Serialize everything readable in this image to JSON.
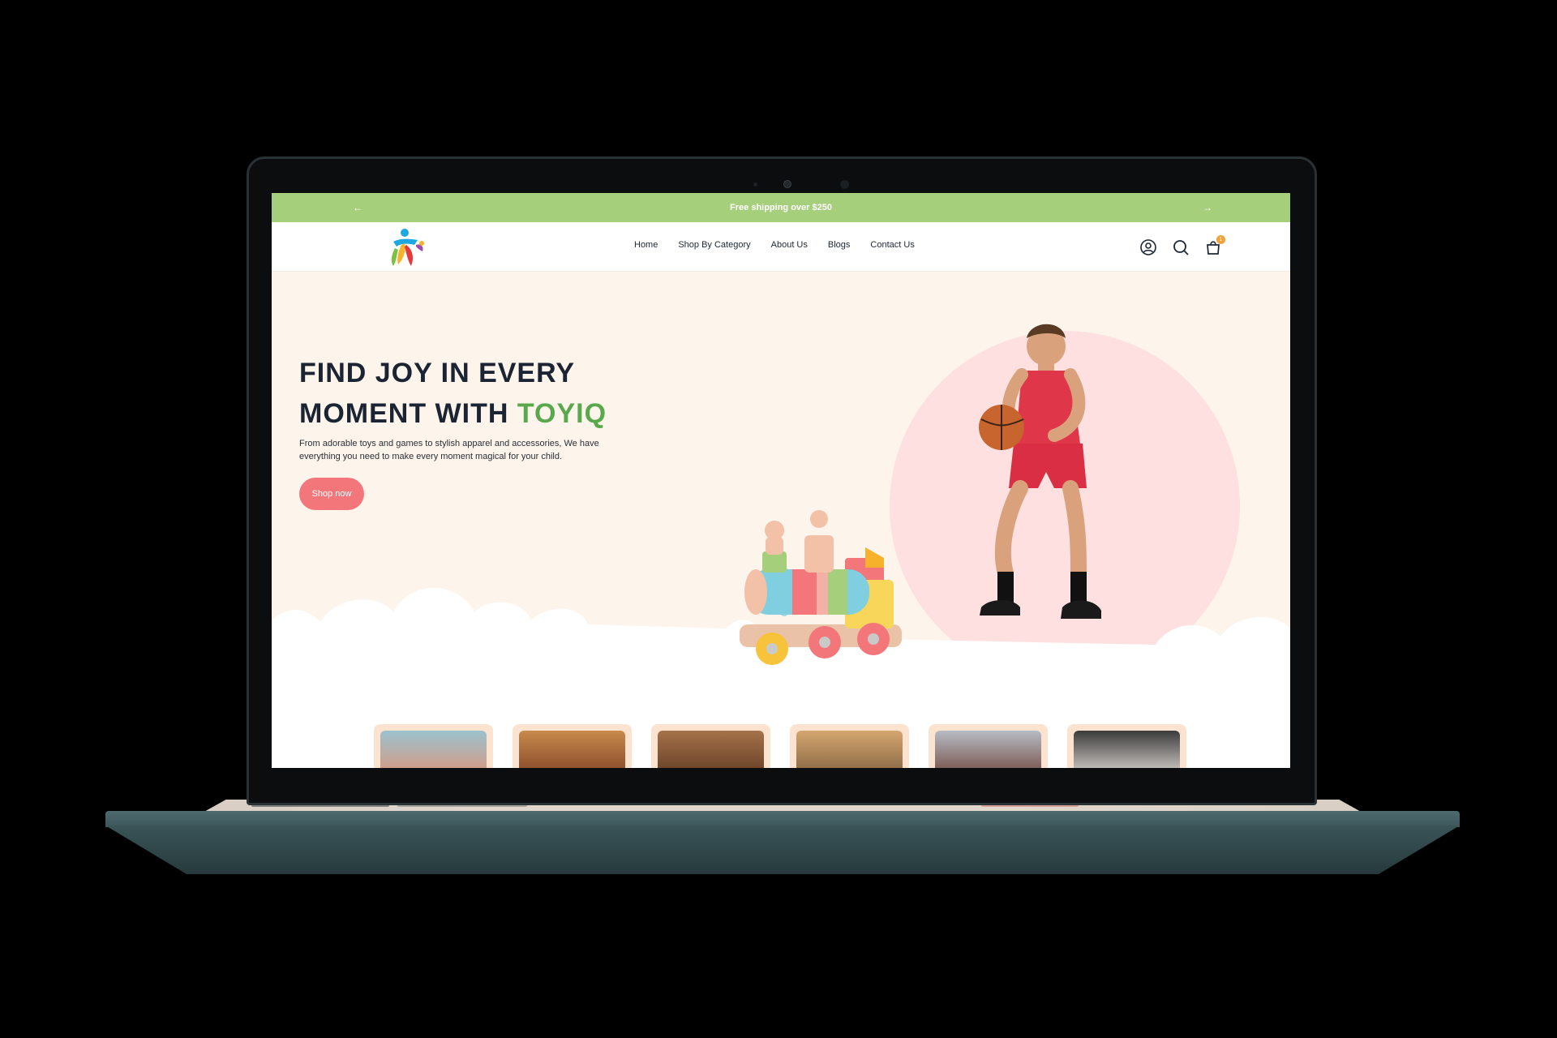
{
  "announcement": {
    "text": "Free shipping over $250",
    "prev_icon": "arrow-left-icon",
    "next_icon": "arrow-right-icon"
  },
  "header": {
    "logo_icon": "toyiq-logo-icon",
    "nav": [
      "Home",
      "Shop By Category",
      "About Us",
      "Blogs",
      "Contact Us"
    ],
    "account_icon": "user-circle-icon",
    "search_icon": "search-icon",
    "cart_icon": "shopping-bag-icon",
    "cart_count": "1"
  },
  "hero": {
    "title_line1": "Find joy in every",
    "title_line2_prefix": "moment with ",
    "title_brand": "Toyiq",
    "description": "From adorable toys and games to stylish apparel and accessories, We have everything you need to make every moment magical for your child.",
    "cta": "Shop now"
  },
  "categories": {
    "count_visible": 6
  },
  "colors": {
    "announcement_bg": "#a6cf7c",
    "hero_bg": "#fdf4ec",
    "brand_green": "#5aa84c",
    "cta_pink": "#f2767a",
    "circle_pink": "#fde0df",
    "laptop_body": "#3a5458"
  }
}
